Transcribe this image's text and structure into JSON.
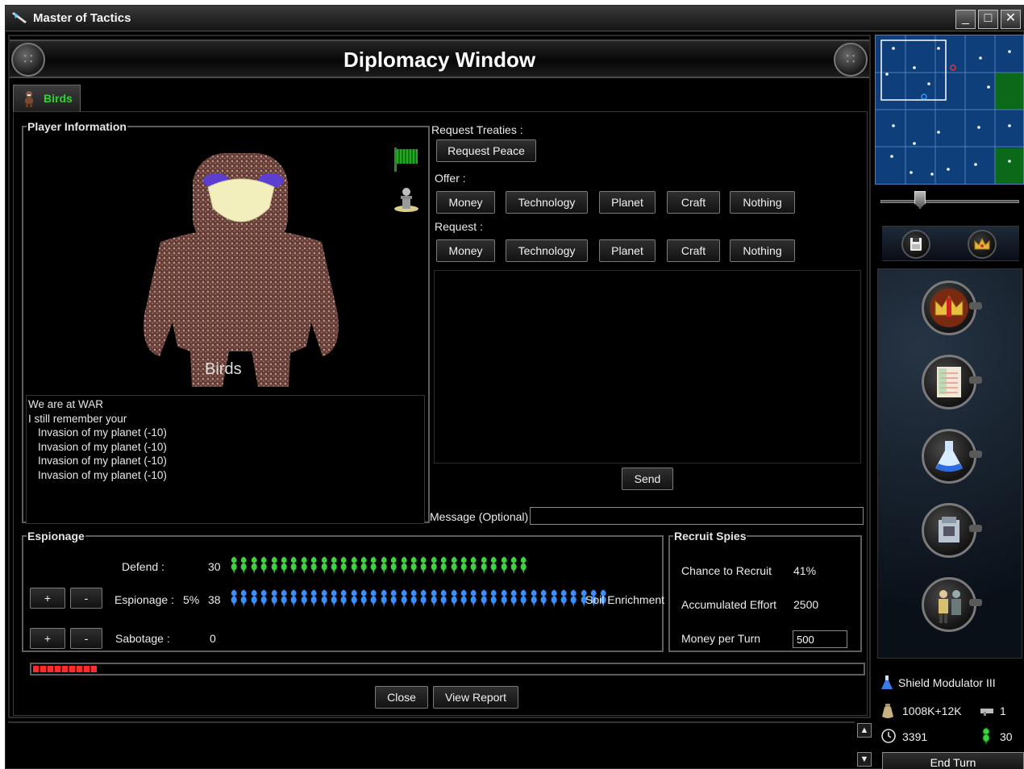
{
  "window": {
    "title": "Master of Tactics",
    "controls": {
      "minimize": "_",
      "maximize": "□",
      "close": "✕"
    }
  },
  "header": {
    "title": "Diplomacy Window"
  },
  "tabs": [
    {
      "label": "Birds",
      "icon": "bird-race-icon",
      "color": "#2fd42f"
    }
  ],
  "player_info": {
    "legend": "Player Information",
    "race_name": "Birds",
    "flag_color": "#22aa22",
    "relations": [
      "We are at WAR",
      "I still remember your",
      "Invasion of my planet (-10)",
      "Invasion of my planet (-10)",
      "Invasion of my planet (-10)",
      "Invasion of my planet (-10)"
    ]
  },
  "treaties": {
    "request_treaties_label": "Request Treaties :",
    "request_peace": "Request Peace",
    "offer_label": "Offer :",
    "request_label": "Request :",
    "offer_options": [
      "Money",
      "Technology",
      "Planet",
      "Craft",
      "Nothing"
    ],
    "request_options": [
      "Money",
      "Technology",
      "Planet",
      "Craft",
      "Nothing"
    ],
    "send": "Send",
    "message_label": "Message (Optional)",
    "message_value": ""
  },
  "espionage": {
    "legend": "Espionage",
    "defend_label": "Defend :",
    "defend_value": "30",
    "espionage_label": "Espionage :",
    "espionage_percent": "5%",
    "espionage_value": "38",
    "espionage_target": "Soil Enrichment",
    "sabotage_label": "Sabotage :",
    "sabotage_value": "0",
    "plus": "+",
    "minus": "-",
    "defend_color": "#3fd23f",
    "espionage_color": "#3a8fff"
  },
  "recruit_spies": {
    "legend": "Recruit Spies",
    "chance_label": "Chance to Recruit",
    "chance_value": "41%",
    "effort_label": "Accumulated Effort",
    "effort_value": "2500",
    "money_label": "Money per Turn",
    "money_value": "500"
  },
  "progress": {
    "fraction": 0.077,
    "color": "#ff2a2a"
  },
  "footer_buttons": {
    "close": "Close",
    "view_report": "View Report"
  },
  "sidebar": {
    "research_item": "Shield Modulator III",
    "money": "1008K+12K",
    "ships": "1",
    "stardate": "3391",
    "spies": "30",
    "end_turn": "End Turn",
    "toolbar_icons": [
      "save-disk-icon",
      "crown-icon"
    ],
    "dock_icons": [
      "crown-leaders-icon",
      "report-sheet-icon",
      "research-flask-icon",
      "ship-design-icon",
      "personnel-icon"
    ]
  }
}
